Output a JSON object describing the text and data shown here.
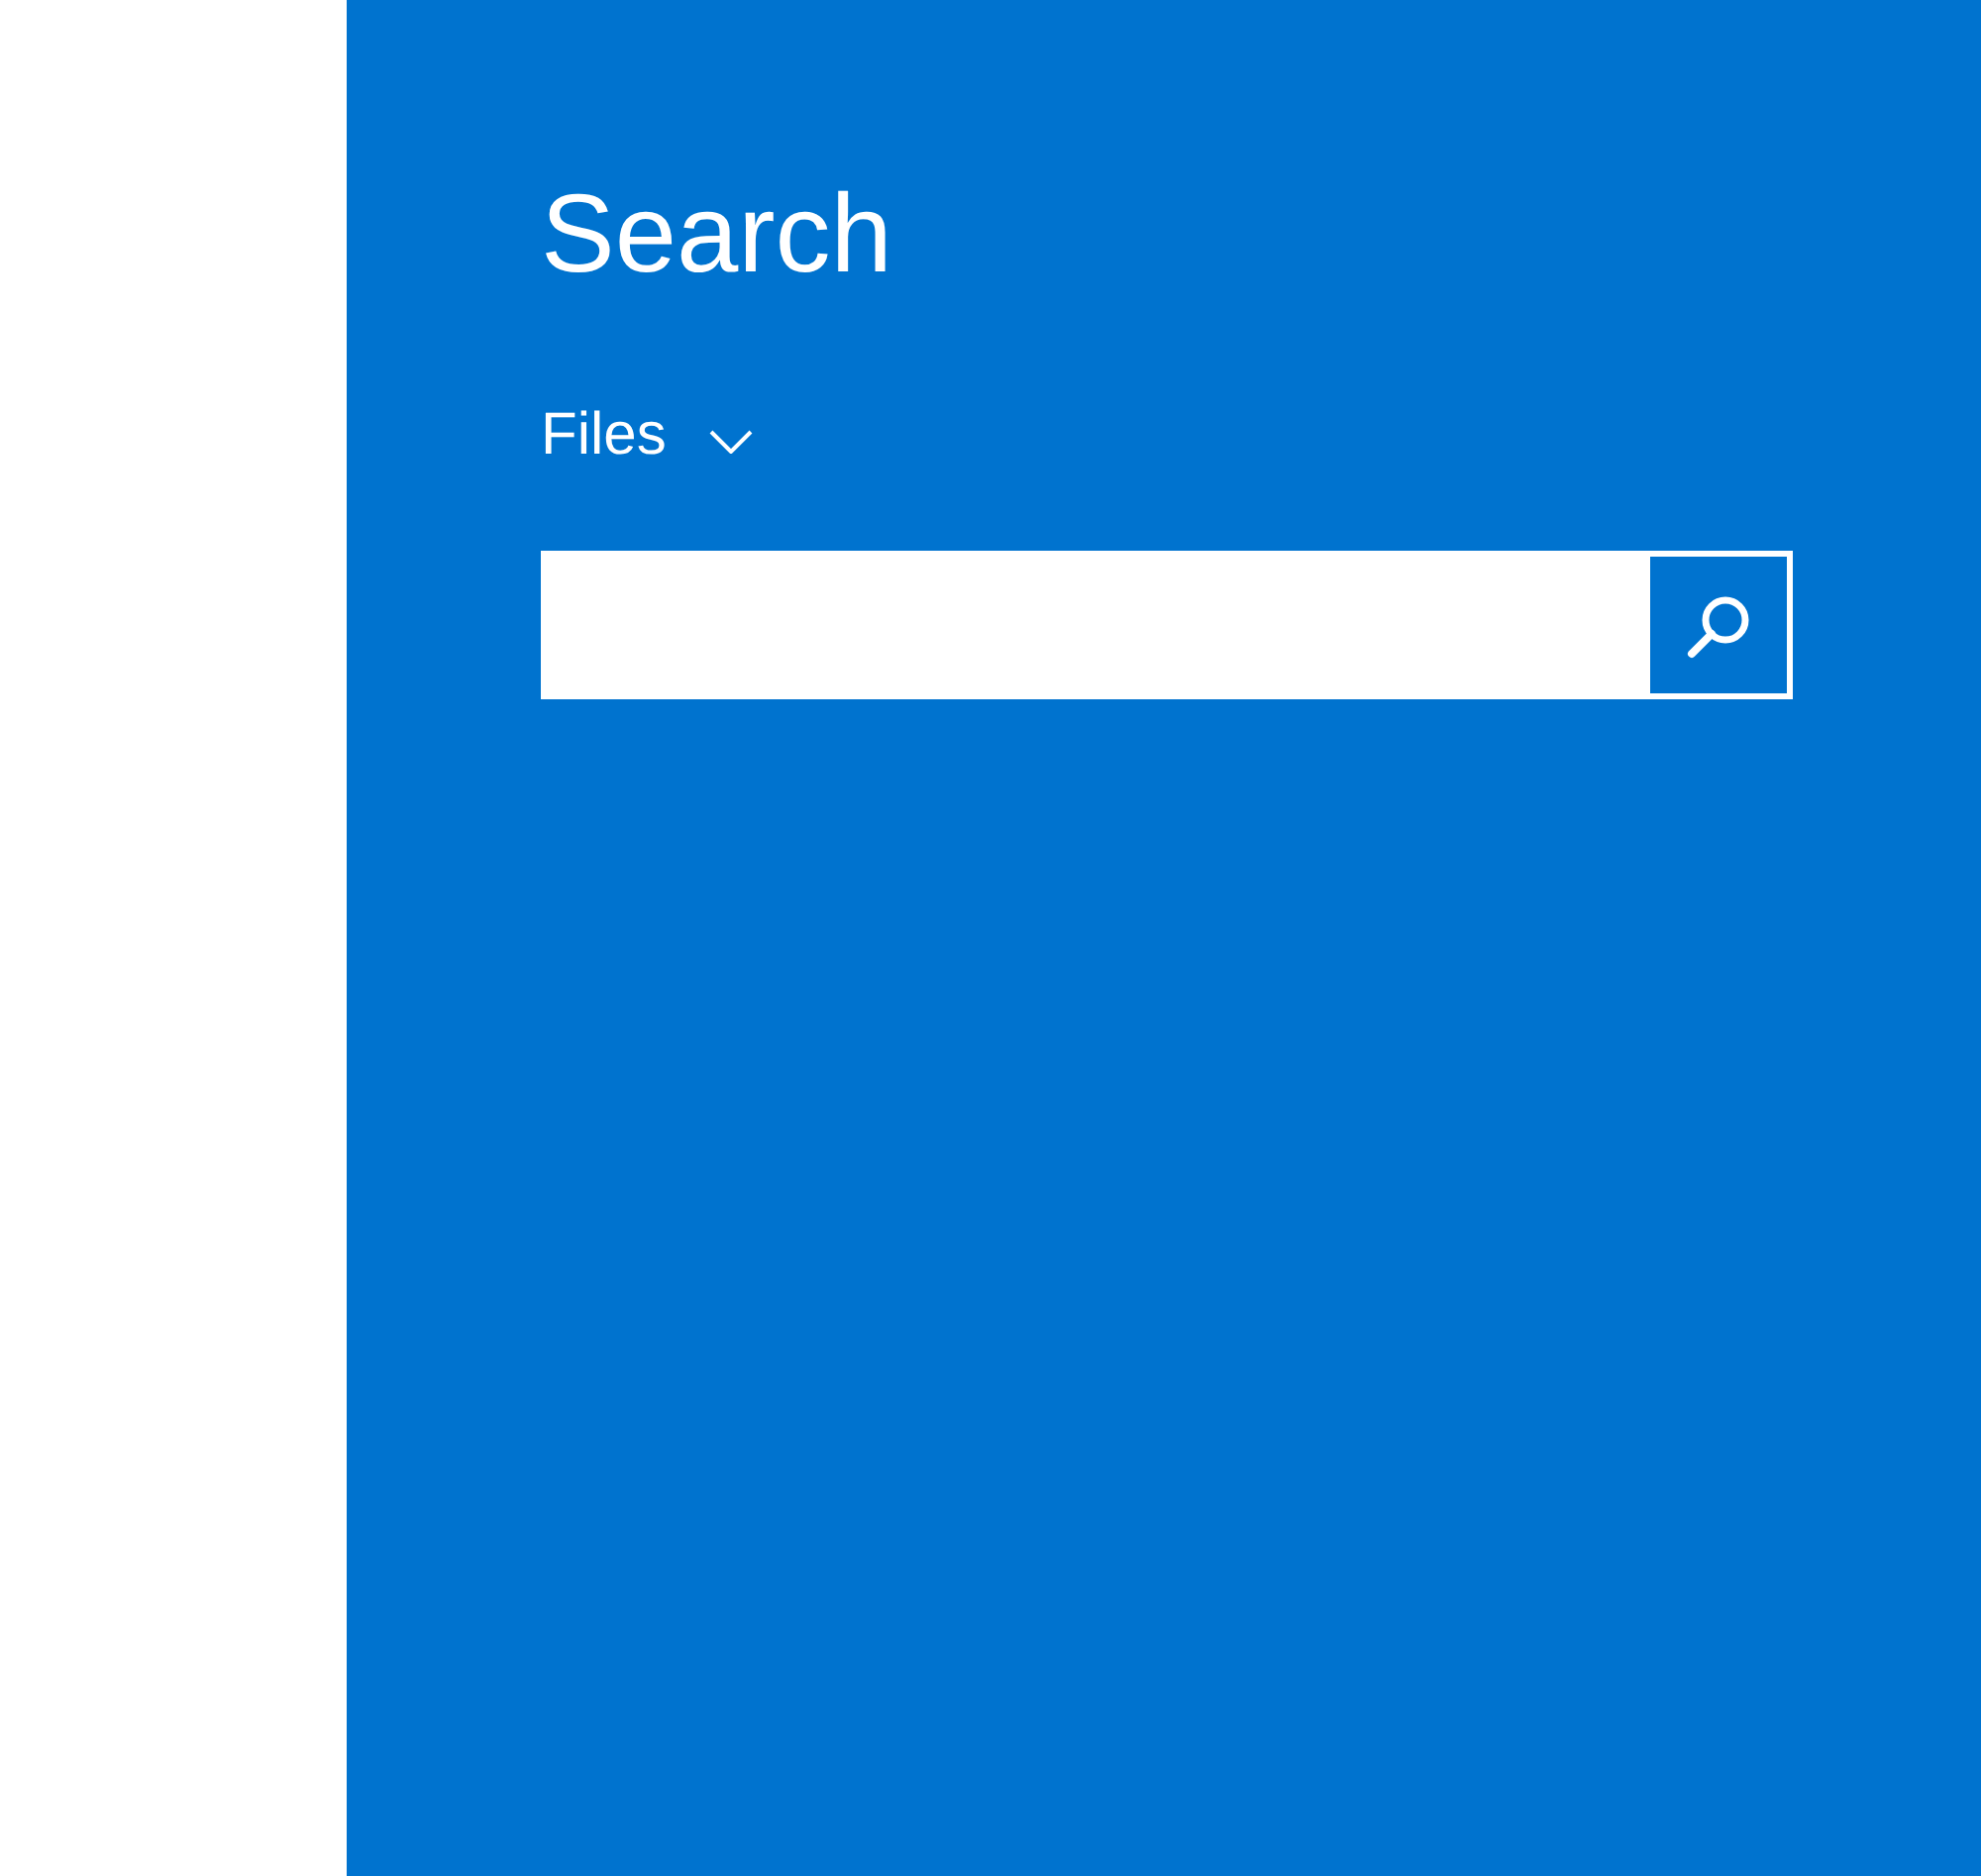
{
  "panel": {
    "title": "Search"
  },
  "scope": {
    "label": "Files"
  }
}
